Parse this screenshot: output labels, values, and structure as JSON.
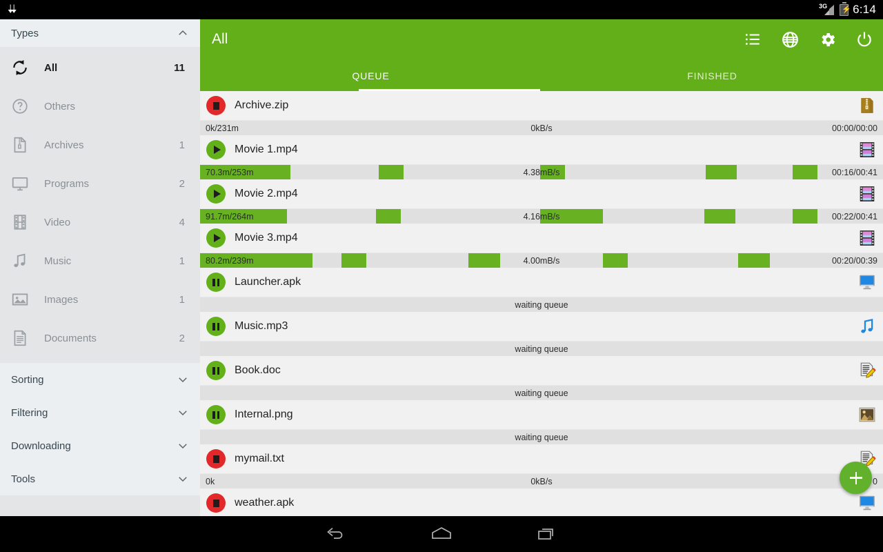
{
  "statusbar": {
    "download_icon": "download-arrows-icon",
    "network_label": "3G",
    "signal_icon": "signal-bars-icon",
    "battery_icon": "battery-charging-icon",
    "clock": "6:14"
  },
  "sidebar": {
    "types_header": {
      "label": "Types",
      "icon": "chevron-up-icon"
    },
    "types": [
      {
        "label": "All",
        "count": "11",
        "icon": "sync-refresh-icon",
        "active": true
      },
      {
        "label": "Others",
        "count": "",
        "icon": "question-mark-icon",
        "active": false
      },
      {
        "label": "Archives",
        "count": "1",
        "icon": "archive-zip-icon",
        "active": false
      },
      {
        "label": "Programs",
        "count": "2",
        "icon": "monitor-icon",
        "active": false
      },
      {
        "label": "Video",
        "count": "4",
        "icon": "film-strip-icon",
        "active": false
      },
      {
        "label": "Music",
        "count": "1",
        "icon": "music-note-icon",
        "active": false
      },
      {
        "label": "Images",
        "count": "1",
        "icon": "image-photo-icon",
        "active": false
      },
      {
        "label": "Documents",
        "count": "2",
        "icon": "document-icon",
        "active": false
      }
    ],
    "sections": [
      {
        "label": "Sorting",
        "icon": "chevron-down-icon"
      },
      {
        "label": "Filtering",
        "icon": "chevron-down-icon"
      },
      {
        "label": "Downloading",
        "icon": "chevron-down-icon"
      },
      {
        "label": "Tools",
        "icon": "chevron-down-icon"
      }
    ]
  },
  "appbar": {
    "title": "All",
    "accent_color": "#62af1a",
    "actions": [
      {
        "name": "list-view-icon",
        "label": "List"
      },
      {
        "name": "globe-icon",
        "label": "Browser"
      },
      {
        "name": "gear-icon",
        "label": "Settings"
      },
      {
        "name": "power-icon",
        "label": "Exit"
      }
    ],
    "tabs": [
      {
        "label": "QUEUE",
        "selected": true
      },
      {
        "label": "FINISHED",
        "selected": false
      }
    ]
  },
  "downloads": [
    {
      "name": "Archive.zip",
      "control": "stop",
      "control_icon": "stop-square-icon",
      "file_icon": "archive-zip-icon",
      "status": "downloading",
      "progress_left": "0k/231m",
      "progress_mid": "0kB/s",
      "progress_right": "00:00/00:00",
      "segments": []
    },
    {
      "name": "Movie 1.mp4",
      "control": "play",
      "control_icon": "play-triangle-icon",
      "file_icon": "film-strip-icon",
      "status": "downloading",
      "progress_left": "70.3m/253m",
      "progress_mid": "4.38mB/s",
      "progress_right": "00:16/00:41",
      "segments": [
        {
          "x": 0.0,
          "w": 13.2
        },
        {
          "x": 26.2,
          "w": 3.6
        },
        {
          "x": 49.8,
          "w": 3.6
        },
        {
          "x": 74.0,
          "w": 4.6
        },
        {
          "x": 86.8,
          "w": 3.6
        }
      ]
    },
    {
      "name": "Movie 2.mp4",
      "control": "play",
      "control_icon": "play-triangle-icon",
      "file_icon": "film-strip-icon",
      "status": "downloading",
      "progress_left": "91.7m/264m",
      "progress_mid": "4.16mB/s",
      "progress_right": "00:22/00:41",
      "segments": [
        {
          "x": 0.0,
          "w": 12.7
        },
        {
          "x": 25.8,
          "w": 3.6
        },
        {
          "x": 49.8,
          "w": 9.2
        },
        {
          "x": 73.8,
          "w": 4.6
        },
        {
          "x": 86.8,
          "w": 3.6
        }
      ]
    },
    {
      "name": "Movie 3.mp4",
      "control": "play",
      "control_icon": "play-triangle-icon",
      "file_icon": "film-strip-icon",
      "status": "downloading",
      "progress_left": "80.2m/239m",
      "progress_mid": "4.00mB/s",
      "progress_right": "00:20/00:39",
      "segments": [
        {
          "x": 0.0,
          "w": 16.5
        },
        {
          "x": 20.7,
          "w": 3.6
        },
        {
          "x": 39.3,
          "w": 4.6
        },
        {
          "x": 59.0,
          "w": 3.6
        },
        {
          "x": 78.8,
          "w": 4.6
        }
      ]
    },
    {
      "name": "Launcher.apk",
      "control": "pause",
      "control_icon": "pause-bars-icon",
      "file_icon": "monitor-program-icon",
      "status": "waiting",
      "progress_mid": "waiting queue",
      "segments": []
    },
    {
      "name": "Music.mp3",
      "control": "pause",
      "control_icon": "pause-bars-icon",
      "file_icon": "music-note-icon",
      "status": "waiting",
      "progress_mid": "waiting queue",
      "segments": []
    },
    {
      "name": "Book.doc",
      "control": "pause",
      "control_icon": "pause-bars-icon",
      "file_icon": "document-pencil-icon",
      "status": "waiting",
      "progress_mid": "waiting queue",
      "segments": []
    },
    {
      "name": "Internal.png",
      "control": "pause",
      "control_icon": "pause-bars-icon",
      "file_icon": "image-photo-icon",
      "status": "waiting",
      "progress_mid": "waiting queue",
      "segments": []
    },
    {
      "name": "mymail.txt",
      "control": "stop",
      "control_icon": "stop-square-icon",
      "file_icon": "document-pencil-icon",
      "status": "downloading",
      "progress_left": "0k",
      "progress_mid": "0kB/s",
      "progress_right": "0",
      "segments": []
    },
    {
      "name": "weather.apk",
      "control": "stop",
      "control_icon": "stop-square-icon",
      "file_icon": "monitor-program-icon",
      "status": "downloading",
      "segments": []
    }
  ],
  "fab": {
    "icon": "plus-icon",
    "label": "Add download"
  },
  "navbar": [
    {
      "name": "back-icon",
      "label": "Back"
    },
    {
      "name": "home-icon",
      "label": "Home"
    },
    {
      "name": "recents-icon",
      "label": "Recents"
    }
  ]
}
